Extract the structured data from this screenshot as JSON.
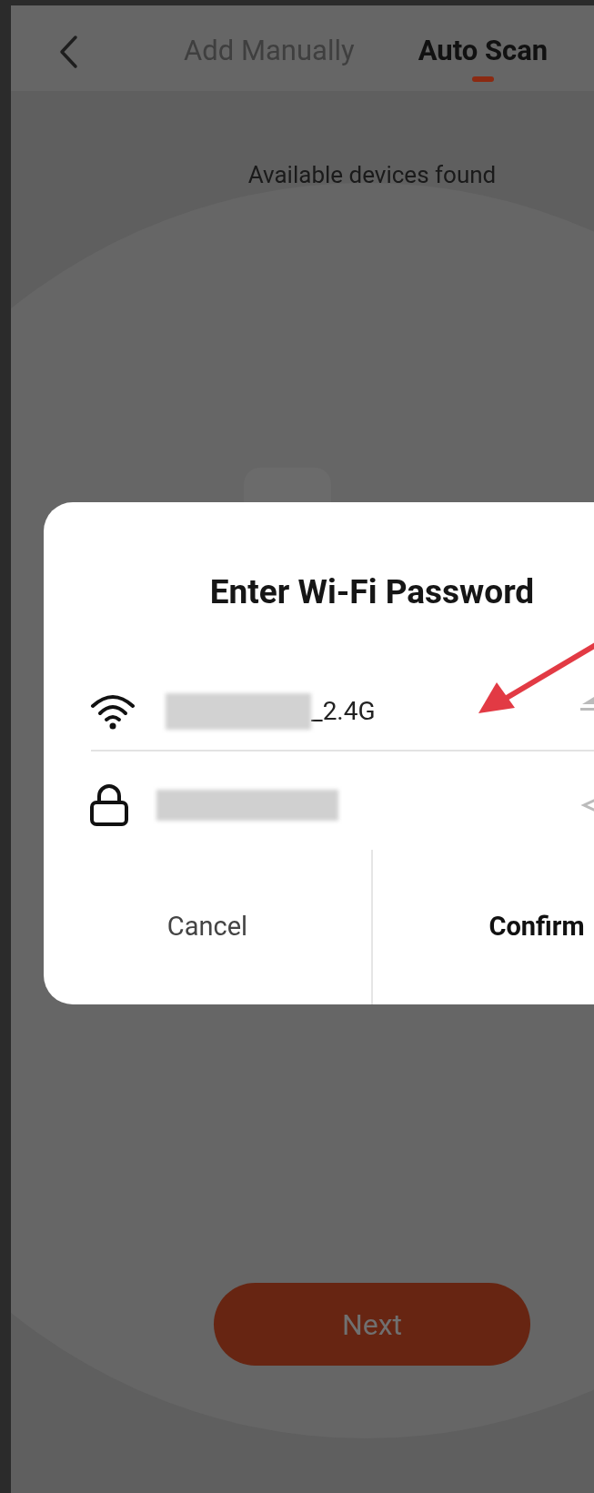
{
  "header": {
    "tabs": [
      {
        "label": "Add Manually",
        "selected": false
      },
      {
        "label": "Auto Scan",
        "selected": true
      }
    ]
  },
  "status_text": "Available devices found",
  "dialog": {
    "title": "Enter Wi-Fi Password",
    "network": "_2.4G",
    "buttons": [
      {
        "label": "Cancel",
        "kind": "secondary"
      },
      {
        "label": "Confirm",
        "kind": "primary"
      }
    ]
  },
  "next_button": "Next"
}
